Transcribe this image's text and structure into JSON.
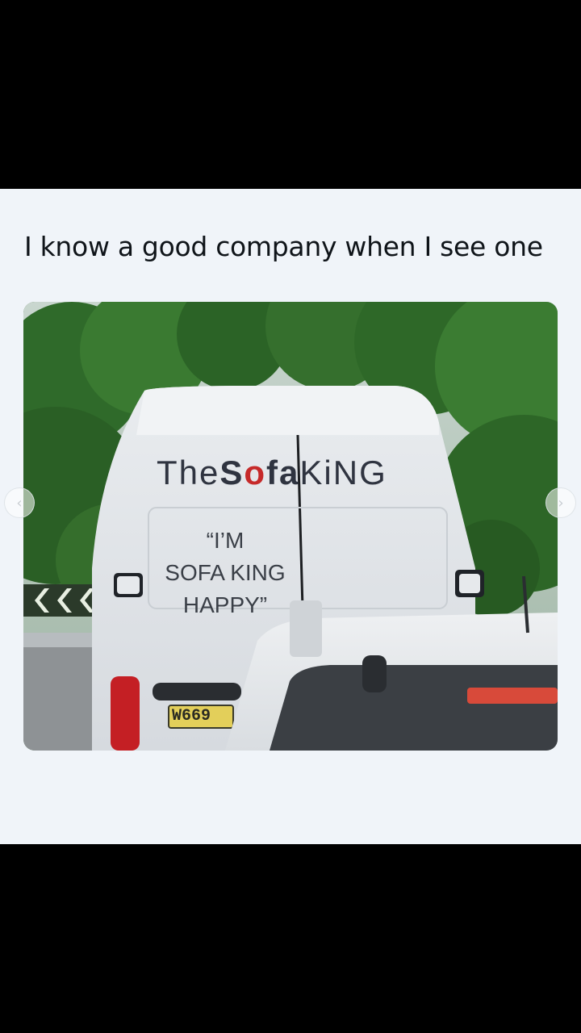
{
  "post": {
    "caption": "I know a good company when I see one"
  },
  "photo": {
    "van_logo": {
      "part1": "The",
      "part2": "S",
      "part3": "o",
      "part4": "fa",
      "part5": "KiNG"
    },
    "van_slogan": {
      "line1": "“I’M",
      "line2": "SOFA KING",
      "line3": "HAPPY”"
    },
    "plate": "W669"
  },
  "carousel": {
    "prev_icon": "chevron-left-icon",
    "next_icon": "chevron-right-icon"
  },
  "colors": {
    "background": "#000000",
    "card": "#f0f4f9",
    "caption_text": "#0f1419",
    "logo_dark": "#2f3440",
    "logo_accent": "#c62a2a"
  }
}
